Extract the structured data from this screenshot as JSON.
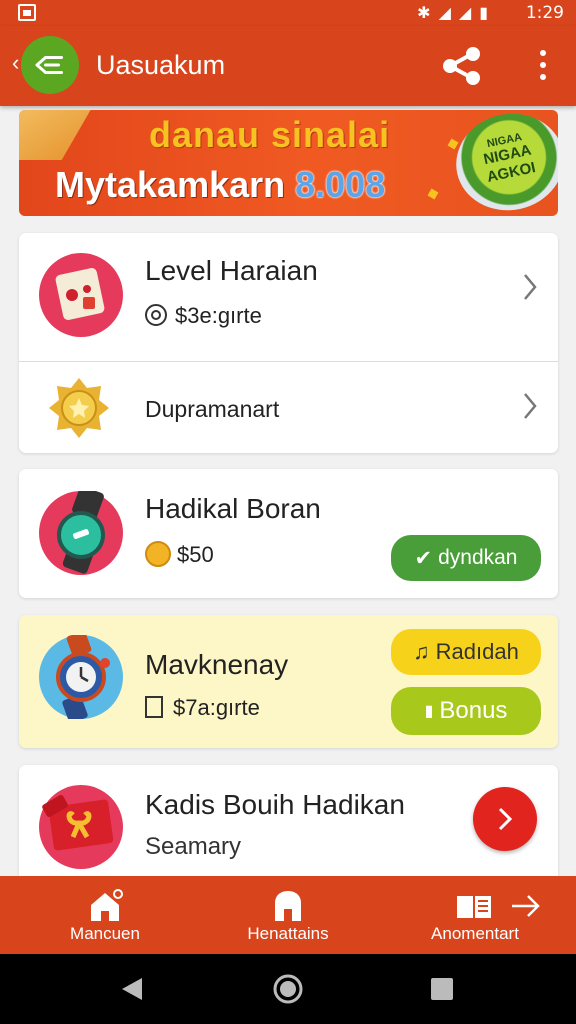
{
  "status_bar": {
    "time": "1:29"
  },
  "app_bar": {
    "title": "Uasuakum"
  },
  "banner": {
    "top_text": "danau sinalai",
    "main_text": "Mytakamkarn",
    "main_number": "8.008",
    "badge_lines": [
      "NIGAA",
      "NIGAA",
      "AGKOI"
    ]
  },
  "card1": {
    "row1": {
      "title": "Level Haraian",
      "subtitle": "$3e:gırte"
    },
    "row2": {
      "title": "Dupramanart"
    }
  },
  "card2": {
    "title": "Hadikal Boran",
    "price": "$50",
    "button": "dyndkan"
  },
  "card3": {
    "title": "Mavknenay",
    "price": "$7a:gırte",
    "button1": "Radıdah",
    "button2": "Bonus"
  },
  "card4": {
    "title": "Kadis Bouih Hadikan",
    "subtitle": "Seamary"
  },
  "bottom_nav": {
    "items": [
      {
        "label": "Mancuen",
        "icon": "home-icon"
      },
      {
        "label": "Henattains",
        "icon": "store-icon"
      },
      {
        "label": "Anomentart",
        "icon": "book-icon"
      }
    ]
  },
  "colors": {
    "primary": "#d8441c",
    "green": "#5ca722",
    "yellow_card": "#fdf6c6",
    "pill_yellow": "#f7d21b",
    "pill_lime": "#a8c81c",
    "action_red": "#e2241e"
  }
}
